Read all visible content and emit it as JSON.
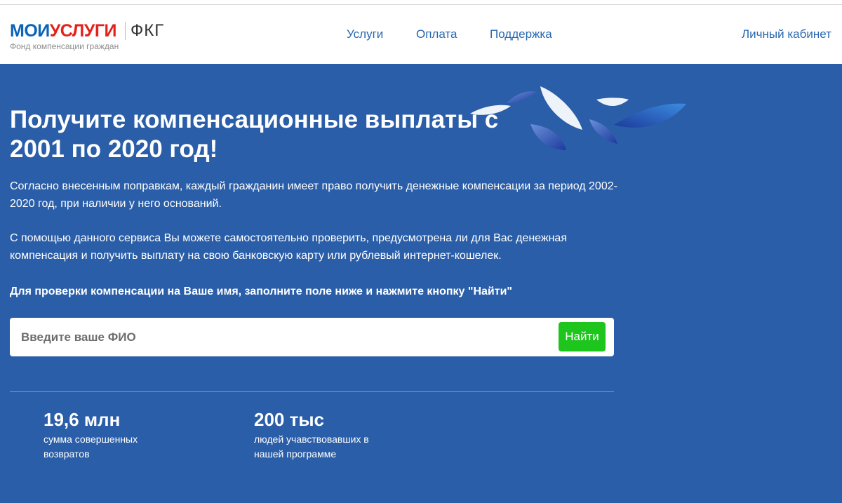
{
  "header": {
    "logo_part1": "МОИ",
    "logo_part2": "УСЛУГИ",
    "logo_abbr": "ФКГ",
    "logo_subtitle": "Фонд компенсации граждан",
    "nav": {
      "services": "Услуги",
      "payment": "Оплата",
      "support": "Поддержка",
      "account": "Личный кабинет"
    }
  },
  "hero": {
    "title": "Получите компенсационные выплаты с 2001 по 2020 год!",
    "paragraph1": "Согласно внесенным поправкам, каждый гражданин имеет право получить денежные компенсации за период 2002-2020 год, при наличии у него оснований.",
    "paragraph2": "С помощью данного сервиса Вы можете самостоятельно проверить, предусмотрена ли для Вас денежная компенсация и получить выплату на свою банковскую карту или рублевый интернет-кошелек.",
    "instruction": "Для проверки компенсации на Ваше имя, заполните поле ниже и нажмите кнопку \"Найти\""
  },
  "search": {
    "placeholder": "Введите ваше ФИО",
    "value": "",
    "button_label": "Найти"
  },
  "stats": [
    {
      "value": "19,6 млн",
      "label": "сумма совершенных возвратов"
    },
    {
      "value": "200 тыс",
      "label": "людей учавствовавших в нашей программе"
    }
  ],
  "colors": {
    "brand_blue": "#0b63b8",
    "brand_red": "#e3221c",
    "hero_background": "#2a5ea8",
    "button_green": "#1ec51d",
    "nav_link": "#2767b0"
  }
}
